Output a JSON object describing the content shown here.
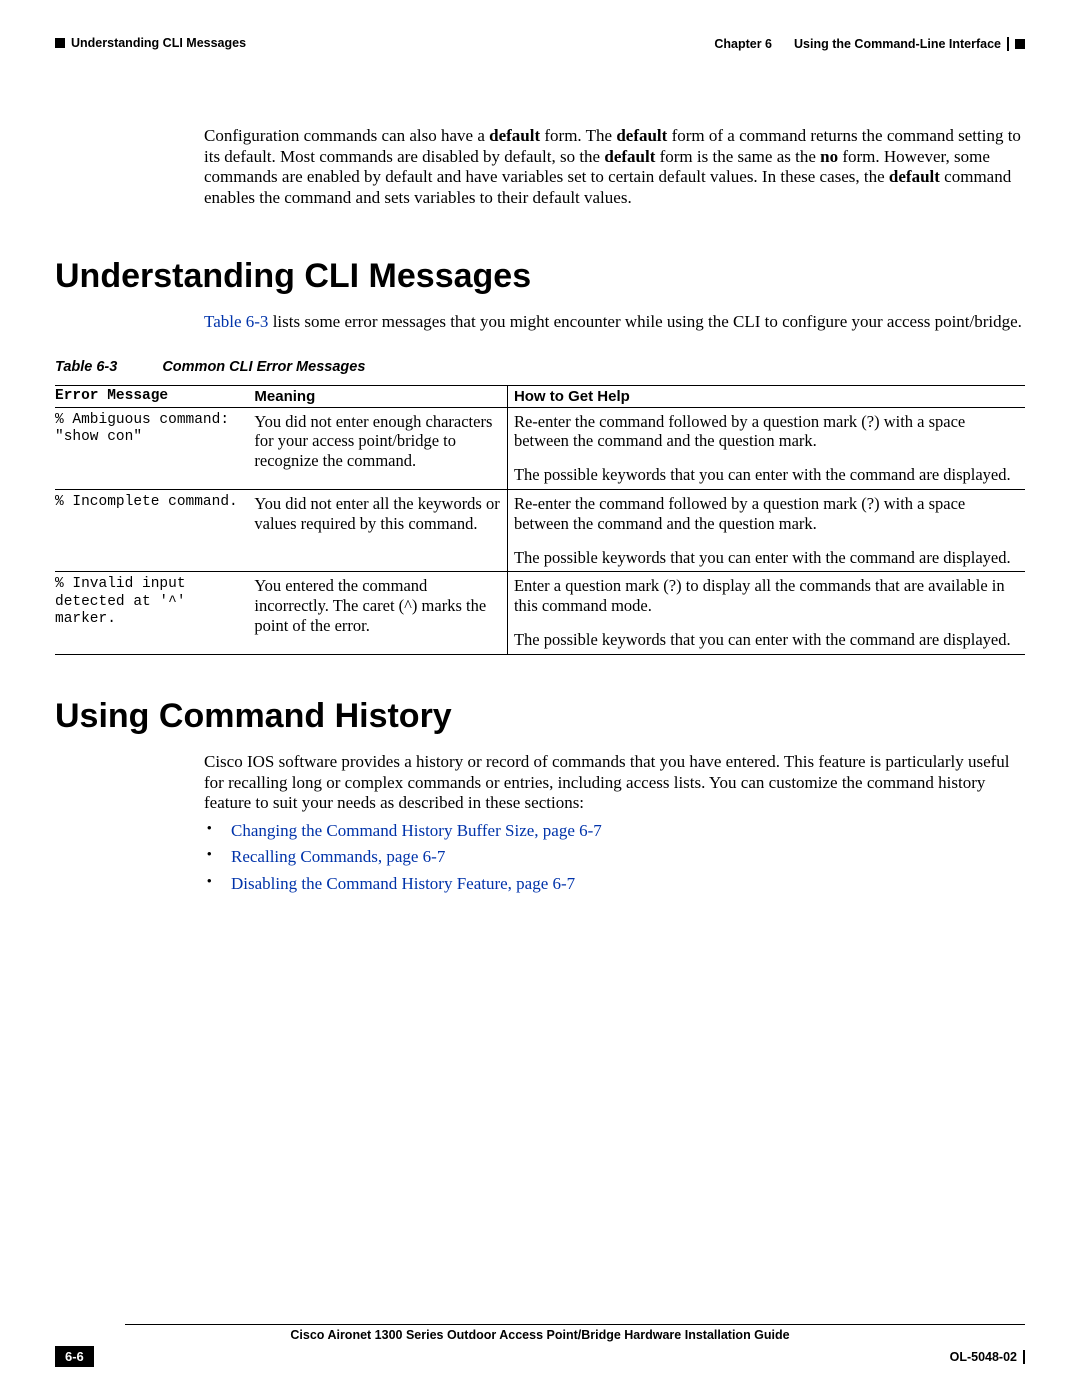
{
  "header": {
    "chapter": "Chapter 6",
    "title": "Using the Command-Line Interface",
    "section_left": "Understanding CLI Messages"
  },
  "intro_paragraph_parts": {
    "p1": "Configuration commands can also have a ",
    "b1": "default",
    "p2": " form. The ",
    "b2": "default",
    "p3": " form of a command returns the command setting to its default. Most commands are disabled by default, so the ",
    "b3": "default",
    "p4": " form is the same as the ",
    "b4": "no",
    "p5": " form. However, some commands are enabled by default and have variables set to certain default values. In these cases, the ",
    "b5": "default",
    "p6": " command enables the command and sets variables to their default values."
  },
  "h1_a": "Understanding CLI Messages",
  "ref_para": {
    "link": "Table 6-3",
    "rest": " lists some error messages that you might encounter while using the CLI to configure your access point/bridge."
  },
  "table_caption": {
    "label": "Table 6-3",
    "title": "Common CLI Error Messages"
  },
  "table": {
    "headers": {
      "c1": "Error Message",
      "c2": "Meaning",
      "c3": "How to Get Help"
    },
    "rows": [
      {
        "err": "% Ambiguous command: \"show con\"",
        "meaning": "You did not enter enough characters for your access point/bridge to recognize the command.",
        "help1": "Re-enter the command followed by a question mark (?) with a space between the command and the question mark.",
        "help2": "The possible keywords that you can enter with the command are displayed."
      },
      {
        "err": "% Incomplete command.",
        "meaning": "You did not enter all the keywords or values required by this command.",
        "help1": "Re-enter the command followed by a question mark (?) with a space between the command and the question mark.",
        "help2": "The possible keywords that you can enter with the command are displayed."
      },
      {
        "err": "% Invalid input detected at '^' marker.",
        "meaning": "You entered the command incorrectly. The caret (^) marks the point of the error.",
        "help1": "Enter a question mark (?) to display all the commands that are available in this command mode.",
        "help2": "The possible keywords that you can enter with the command are displayed."
      }
    ]
  },
  "h1_b": "Using Command History",
  "hist_para": "Cisco IOS software provides a history or record of commands that you have entered. This feature is particularly useful for recalling long or complex commands or entries, including access lists. You can customize the command history feature to suit your needs as described in these sections:",
  "links": [
    "Changing the Command History Buffer Size, page 6-7",
    "Recalling Commands, page 6-7",
    "Disabling the Command History Feature, page 6-7"
  ],
  "footer": {
    "guide": "Cisco Aironet 1300 Series Outdoor Access Point/Bridge Hardware Installation Guide",
    "page": "6-6",
    "ol": "OL-5048-02"
  }
}
